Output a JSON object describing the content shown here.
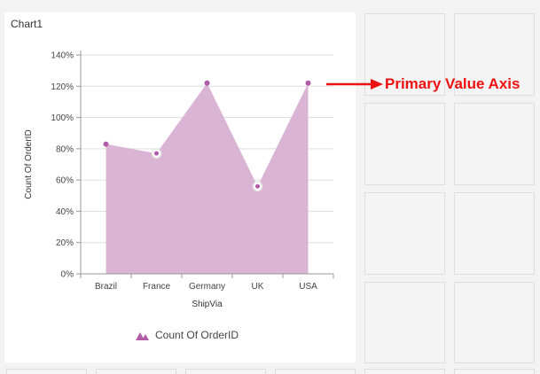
{
  "panel": {
    "title": "Chart1"
  },
  "annotation": {
    "text": "Primary Value Axis",
    "color": "#ee1111"
  },
  "chart_data": {
    "type": "area",
    "title": "",
    "categories": [
      "Brazil",
      "France",
      "Germany",
      "UK",
      "USA"
    ],
    "series": [
      {
        "name": "Count Of OrderID",
        "values": [
          83,
          77,
          122,
          56,
          122
        ]
      }
    ],
    "value_axis": {
      "min": 0,
      "max": 140,
      "interval": 20,
      "tick_labels": [
        "0%",
        "20%",
        "40%",
        "60%",
        "80%",
        "100%",
        "120%",
        "140%"
      ]
    },
    "xlabel": "ShipVia",
    "ylabel": "Count Of OrderID",
    "grid": true,
    "legend": {
      "position": "bottom",
      "label": "Count Of OrderID"
    },
    "colors": {
      "fill": "#dab4d5",
      "marker": "#b05aa8",
      "highlight_marker_fill": "#ffffff"
    },
    "highlighted_points": [
      "France",
      "UK"
    ]
  }
}
